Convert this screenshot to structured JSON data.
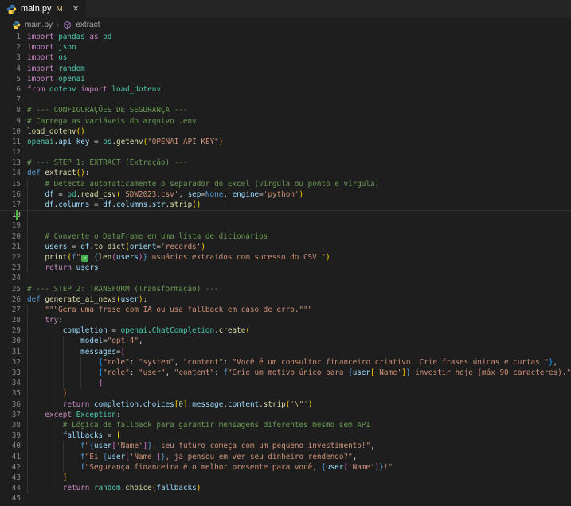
{
  "window": {
    "tab": {
      "title": "main.py",
      "git_badge": "M"
    }
  },
  "icons": {
    "close": "✕",
    "breadcrumb_separator": "›"
  },
  "breadcrumb": {
    "items": [
      {
        "label": "main.py",
        "icon": "python-icon"
      },
      {
        "label": "extract",
        "icon": "symbol-method-icon"
      }
    ]
  },
  "colors": {
    "ui": {
      "bg": "#1e1e1e",
      "tabstrip": "#252526",
      "gutter": "#858585",
      "activeLineNumber": "#c6c6c6",
      "guide": "#333333",
      "gitAdded": "#4bb54b",
      "activeLineBorder": "#303030",
      "breadcrumbText": "#a9a9a9",
      "tabText": "#ffffff",
      "modified": "#e2c08d",
      "closeIcon": "#c5c5c5",
      "checkGreen": "#4caf50",
      "pythonBlue": "#3776ab",
      "pythonYellow": "#ffd43b",
      "methodPurple": "#b180d7"
    },
    "syntax": {
      "kw": "#c586c0",
      "def": "#569cd6",
      "fn": "#dcdcaa",
      "type": "#4ec9b0",
      "var": "#9cdcfe",
      "str": "#ce9178",
      "esc": "#d7ba7d",
      "num": "#b5cea8",
      "cm": "#6a9955",
      "op": "#d4d4d4",
      "b1": "#ffd700",
      "b2": "#da70d6",
      "b3": "#179fff",
      "fb": "#569cd6"
    }
  },
  "editor": {
    "active_line": 18,
    "git_added_lines": [
      18
    ],
    "lines": [
      {
        "n": 1,
        "tokens": [
          [
            "kw",
            "import "
          ],
          [
            "type",
            "pandas"
          ],
          [
            "kw",
            " as "
          ],
          [
            "type",
            "pd"
          ]
        ]
      },
      {
        "n": 2,
        "tokens": [
          [
            "kw",
            "import "
          ],
          [
            "type",
            "json"
          ]
        ]
      },
      {
        "n": 3,
        "tokens": [
          [
            "kw",
            "import "
          ],
          [
            "type",
            "os"
          ]
        ]
      },
      {
        "n": 4,
        "tokens": [
          [
            "kw",
            "import "
          ],
          [
            "type",
            "random"
          ]
        ]
      },
      {
        "n": 5,
        "tokens": [
          [
            "kw",
            "import "
          ],
          [
            "type",
            "openai"
          ]
        ]
      },
      {
        "n": 6,
        "tokens": [
          [
            "kw",
            "from "
          ],
          [
            "type",
            "dotenv"
          ],
          [
            "kw",
            " import "
          ],
          [
            "type",
            "load_dotenv"
          ]
        ]
      },
      {
        "n": 7,
        "tokens": []
      },
      {
        "n": 8,
        "tokens": [
          [
            "cm",
            "# --- CONFIGURAÇÕES DE SEGURANÇA ---"
          ]
        ]
      },
      {
        "n": 9,
        "tokens": [
          [
            "cm",
            "# Carrega as variáveis do arquivo .env"
          ]
        ]
      },
      {
        "n": 10,
        "tokens": [
          [
            "fn",
            "load_dotenv"
          ],
          [
            "b1",
            "()"
          ]
        ]
      },
      {
        "n": 11,
        "tokens": [
          [
            "type",
            "openai"
          ],
          [
            "op",
            "."
          ],
          [
            "var",
            "api_key"
          ],
          [
            "op",
            " = "
          ],
          [
            "type",
            "os"
          ],
          [
            "op",
            "."
          ],
          [
            "fn",
            "getenv"
          ],
          [
            "b1",
            "("
          ],
          [
            "str",
            "\"OPENAI_API_KEY\""
          ],
          [
            "b1",
            ")"
          ]
        ]
      },
      {
        "n": 12,
        "tokens": []
      },
      {
        "n": 13,
        "tokens": [
          [
            "cm",
            "# --- STEP 1: EXTRACT (Extração) ---"
          ]
        ]
      },
      {
        "n": 14,
        "tokens": [
          [
            "def",
            "def "
          ],
          [
            "fn",
            "extract"
          ],
          [
            "b1",
            "()"
          ],
          [
            "op",
            ":"
          ]
        ]
      },
      {
        "n": 15,
        "tokens": [
          [
            "ws",
            "    "
          ],
          [
            "cm",
            "# Detecta automaticamente o separador do Excel (vírgula ou ponto e vírgula)"
          ]
        ]
      },
      {
        "n": 16,
        "tokens": [
          [
            "ws",
            "    "
          ],
          [
            "var",
            "df"
          ],
          [
            "op",
            " = "
          ],
          [
            "type",
            "pd"
          ],
          [
            "op",
            "."
          ],
          [
            "fn",
            "read_csv"
          ],
          [
            "b1",
            "("
          ],
          [
            "str",
            "'SDW2023.csv'"
          ],
          [
            "op",
            ", "
          ],
          [
            "var",
            "sep"
          ],
          [
            "op",
            "="
          ],
          [
            "def",
            "None"
          ],
          [
            "op",
            ", "
          ],
          [
            "var",
            "engine"
          ],
          [
            "op",
            "="
          ],
          [
            "str",
            "'python'"
          ],
          [
            "b1",
            ")"
          ]
        ]
      },
      {
        "n": 17,
        "tokens": [
          [
            "ws",
            "    "
          ],
          [
            "var",
            "df"
          ],
          [
            "op",
            "."
          ],
          [
            "var",
            "columns"
          ],
          [
            "op",
            " = "
          ],
          [
            "var",
            "df"
          ],
          [
            "op",
            "."
          ],
          [
            "var",
            "columns"
          ],
          [
            "op",
            "."
          ],
          [
            "var",
            "str"
          ],
          [
            "op",
            "."
          ],
          [
            "fn",
            "strip"
          ],
          [
            "b1",
            "()"
          ]
        ]
      },
      {
        "n": 18,
        "tokens": []
      },
      {
        "n": 19,
        "tokens": []
      },
      {
        "n": 20,
        "tokens": [
          [
            "ws",
            "    "
          ],
          [
            "cm",
            "# Converte o DataFrame em uma lista de dicionários"
          ]
        ]
      },
      {
        "n": 21,
        "tokens": [
          [
            "ws",
            "    "
          ],
          [
            "var",
            "users"
          ],
          [
            "op",
            " = "
          ],
          [
            "var",
            "df"
          ],
          [
            "op",
            "."
          ],
          [
            "fn",
            "to_dict"
          ],
          [
            "b1",
            "("
          ],
          [
            "var",
            "orient"
          ],
          [
            "op",
            "="
          ],
          [
            "str",
            "'records'"
          ],
          [
            "b1",
            ")"
          ]
        ]
      },
      {
        "n": 22,
        "tokens": [
          [
            "ws",
            "    "
          ],
          [
            "fn",
            "print"
          ],
          [
            "b1",
            "("
          ],
          [
            "def",
            "f"
          ],
          [
            "str",
            "\""
          ],
          [
            "check",
            ""
          ],
          [
            "str",
            " "
          ],
          [
            "fb",
            "{"
          ],
          [
            "fn",
            "len"
          ],
          [
            "b2",
            "("
          ],
          [
            "var",
            "users"
          ],
          [
            "b2",
            ")"
          ],
          [
            "fb",
            "}"
          ],
          [
            "str",
            " usuários extraídos com sucesso do CSV.\""
          ],
          [
            "b1",
            ")"
          ]
        ]
      },
      {
        "n": 23,
        "tokens": [
          [
            "ws",
            "    "
          ],
          [
            "kw",
            "return "
          ],
          [
            "var",
            "users"
          ]
        ]
      },
      {
        "n": 24,
        "tokens": []
      },
      {
        "n": 25,
        "tokens": [
          [
            "cm",
            "# --- STEP 2: TRANSFORM (Transformação) ---"
          ]
        ]
      },
      {
        "n": 26,
        "tokens": [
          [
            "def",
            "def "
          ],
          [
            "fn",
            "generate_ai_news"
          ],
          [
            "b1",
            "("
          ],
          [
            "var",
            "user"
          ],
          [
            "b1",
            ")"
          ],
          [
            "op",
            ":"
          ]
        ]
      },
      {
        "n": 27,
        "tokens": [
          [
            "ws",
            "    "
          ],
          [
            "str",
            "\"\"\"Gera uma frase com IA ou usa fallback em caso de erro.\"\"\""
          ]
        ]
      },
      {
        "n": 28,
        "tokens": [
          [
            "ws",
            "    "
          ],
          [
            "kw",
            "try"
          ],
          [
            "op",
            ":"
          ]
        ]
      },
      {
        "n": 29,
        "tokens": [
          [
            "ws",
            "        "
          ],
          [
            "var",
            "completion"
          ],
          [
            "op",
            " = "
          ],
          [
            "type",
            "openai"
          ],
          [
            "op",
            "."
          ],
          [
            "type",
            "ChatCompletion"
          ],
          [
            "op",
            "."
          ],
          [
            "fn",
            "create"
          ],
          [
            "b1",
            "("
          ]
        ]
      },
      {
        "n": 30,
        "tokens": [
          [
            "ws",
            "            "
          ],
          [
            "var",
            "model"
          ],
          [
            "op",
            "="
          ],
          [
            "str",
            "\"gpt-4\""
          ],
          [
            "op",
            ","
          ]
        ]
      },
      {
        "n": 31,
        "tokens": [
          [
            "ws",
            "            "
          ],
          [
            "var",
            "messages"
          ],
          [
            "op",
            "="
          ],
          [
            "b2",
            "["
          ]
        ]
      },
      {
        "n": 32,
        "tokens": [
          [
            "ws",
            "                "
          ],
          [
            "b3",
            "{"
          ],
          [
            "str",
            "\"role\""
          ],
          [
            "op",
            ": "
          ],
          [
            "str",
            "\"system\""
          ],
          [
            "op",
            ", "
          ],
          [
            "str",
            "\"content\""
          ],
          [
            "op",
            ": "
          ],
          [
            "str",
            "\"Você é um consultor financeiro criativo. Crie frases únicas e curtas.\""
          ],
          [
            "b3",
            "}"
          ],
          [
            "op",
            ","
          ]
        ]
      },
      {
        "n": 33,
        "tokens": [
          [
            "ws",
            "                "
          ],
          [
            "b3",
            "{"
          ],
          [
            "str",
            "\"role\""
          ],
          [
            "op",
            ": "
          ],
          [
            "str",
            "\"user\""
          ],
          [
            "op",
            ", "
          ],
          [
            "str",
            "\"content\""
          ],
          [
            "op",
            ": "
          ],
          [
            "def",
            "f"
          ],
          [
            "str",
            "\"Crie um motivo único para "
          ],
          [
            "fb",
            "{"
          ],
          [
            "var",
            "user"
          ],
          [
            "b1",
            "["
          ],
          [
            "str",
            "'Name'"
          ],
          [
            "b1",
            "]"
          ],
          [
            "fb",
            "}"
          ],
          [
            "str",
            " investir hoje (máx 90 caracteres).\""
          ],
          [
            "b3",
            "}"
          ]
        ]
      },
      {
        "n": 34,
        "tokens": [
          [
            "ws",
            "                "
          ],
          [
            "b2",
            "]"
          ]
        ]
      },
      {
        "n": 35,
        "tokens": [
          [
            "ws",
            "        "
          ],
          [
            "b1",
            ")"
          ]
        ]
      },
      {
        "n": 36,
        "tokens": [
          [
            "ws",
            "        "
          ],
          [
            "kw",
            "return "
          ],
          [
            "var",
            "completion"
          ],
          [
            "op",
            "."
          ],
          [
            "var",
            "choices"
          ],
          [
            "b1",
            "["
          ],
          [
            "num",
            "0"
          ],
          [
            "b1",
            "]"
          ],
          [
            "op",
            "."
          ],
          [
            "var",
            "message"
          ],
          [
            "op",
            "."
          ],
          [
            "var",
            "content"
          ],
          [
            "op",
            "."
          ],
          [
            "fn",
            "strip"
          ],
          [
            "b1",
            "("
          ],
          [
            "str",
            "'"
          ],
          [
            "esc",
            "\\\""
          ],
          [
            "str",
            "'"
          ],
          [
            "b1",
            ")"
          ]
        ]
      },
      {
        "n": 37,
        "tokens": [
          [
            "ws",
            "    "
          ],
          [
            "kw",
            "except "
          ],
          [
            "type",
            "Exception"
          ],
          [
            "op",
            ":"
          ]
        ]
      },
      {
        "n": 38,
        "tokens": [
          [
            "ws",
            "        "
          ],
          [
            "cm",
            "# Lógica de fallback para garantir mensagens diferentes mesmo sem API"
          ]
        ]
      },
      {
        "n": 39,
        "tokens": [
          [
            "ws",
            "        "
          ],
          [
            "var",
            "fallbacks"
          ],
          [
            "op",
            " = "
          ],
          [
            "b1",
            "["
          ]
        ]
      },
      {
        "n": 40,
        "tokens": [
          [
            "ws",
            "            "
          ],
          [
            "def",
            "f"
          ],
          [
            "str",
            "\""
          ],
          [
            "fb",
            "{"
          ],
          [
            "var",
            "user"
          ],
          [
            "b2",
            "["
          ],
          [
            "str",
            "'Name'"
          ],
          [
            "b2",
            "]"
          ],
          [
            "fb",
            "}"
          ],
          [
            "str",
            ", seu futuro começa com um pequeno investimento!\""
          ],
          [
            "op",
            ","
          ]
        ]
      },
      {
        "n": 41,
        "tokens": [
          [
            "ws",
            "            "
          ],
          [
            "def",
            "f"
          ],
          [
            "str",
            "\"Ei "
          ],
          [
            "fb",
            "{"
          ],
          [
            "var",
            "user"
          ],
          [
            "b2",
            "["
          ],
          [
            "str",
            "'Name'"
          ],
          [
            "b2",
            "]"
          ],
          [
            "fb",
            "}"
          ],
          [
            "str",
            ", já pensou em ver seu dinheiro rendendo?\""
          ],
          [
            "op",
            ","
          ]
        ]
      },
      {
        "n": 42,
        "tokens": [
          [
            "ws",
            "            "
          ],
          [
            "def",
            "f"
          ],
          [
            "str",
            "\"Segurança financeira é o melhor presente para você, "
          ],
          [
            "fb",
            "{"
          ],
          [
            "var",
            "user"
          ],
          [
            "b2",
            "["
          ],
          [
            "str",
            "'Name'"
          ],
          [
            "b2",
            "]"
          ],
          [
            "fb",
            "}"
          ],
          [
            "str",
            "!\""
          ]
        ]
      },
      {
        "n": 43,
        "tokens": [
          [
            "ws",
            "        "
          ],
          [
            "b1",
            "]"
          ]
        ]
      },
      {
        "n": 44,
        "tokens": [
          [
            "ws",
            "        "
          ],
          [
            "kw",
            "return "
          ],
          [
            "type",
            "random"
          ],
          [
            "op",
            "."
          ],
          [
            "fn",
            "choice"
          ],
          [
            "b1",
            "("
          ],
          [
            "var",
            "fallbacks"
          ],
          [
            "b1",
            ")"
          ]
        ]
      },
      {
        "n": 45,
        "tokens": []
      }
    ]
  }
}
